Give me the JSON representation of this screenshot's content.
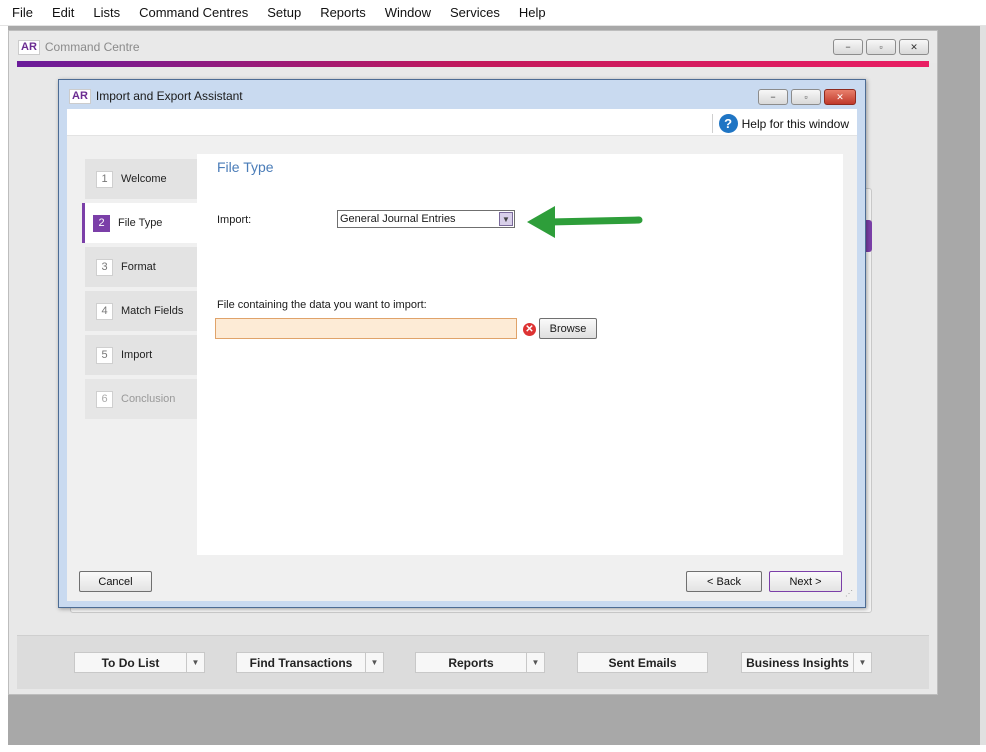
{
  "menu": [
    "File",
    "Edit",
    "Lists",
    "Command Centres",
    "Setup",
    "Reports",
    "Window",
    "Services",
    "Help"
  ],
  "app": {
    "badge": "AR",
    "title": "Command Centre"
  },
  "window_controls": {
    "minimize": "−",
    "restore": "▫",
    "close": "✕"
  },
  "dialog": {
    "badge": "AR",
    "title": "Import and Export Assistant",
    "help_label": "Help for this window",
    "help_icon": "?",
    "steps": [
      {
        "num": "1",
        "label": "Welcome",
        "state": "normal"
      },
      {
        "num": "2",
        "label": "File Type",
        "state": "active"
      },
      {
        "num": "3",
        "label": "Format",
        "state": "normal"
      },
      {
        "num": "4",
        "label": "Match Fields",
        "state": "normal"
      },
      {
        "num": "5",
        "label": "Import",
        "state": "normal"
      },
      {
        "num": "6",
        "label": "Conclusion",
        "state": "disabled"
      }
    ],
    "content_title": "File Type",
    "import_label": "Import:",
    "import_value": "General Journal Entries",
    "file_label": "File containing the data you want to import:",
    "file_value": "",
    "browse_label": "Browse",
    "cancel_label": "Cancel",
    "back_label": "< Back",
    "next_label": "Next >"
  },
  "bottom_bar": [
    {
      "label": "To Do List",
      "has_dropdown": true
    },
    {
      "label": "Find Transactions",
      "has_dropdown": true
    },
    {
      "label": "Reports",
      "has_dropdown": true
    },
    {
      "label": "Sent Emails",
      "has_dropdown": false
    },
    {
      "label": "Business Insights",
      "has_dropdown": true
    }
  ],
  "colors": {
    "accent_purple": "#7b3fa8",
    "title_blue": "#4a7cb8",
    "arrow_green": "#2e9e3a",
    "error_red": "#dd3333"
  }
}
